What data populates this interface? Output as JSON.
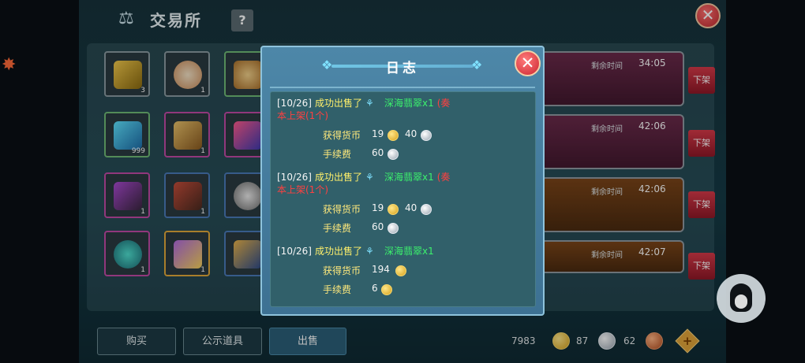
{
  "trade": {
    "title": "交易所",
    "help_label": "?",
    "close_label": "✕",
    "inventory": [
      {
        "count": "3"
      },
      {
        "count": "1"
      },
      {
        "count": ""
      },
      {
        "count": "999"
      },
      {
        "count": "1"
      },
      {
        "count": ""
      },
      {
        "count": "1"
      },
      {
        "count": "1"
      },
      {
        "count": ""
      },
      {
        "count": "1"
      },
      {
        "count": "1"
      },
      {
        "count": ""
      }
    ],
    "listings": [
      {
        "time_label": "剩余时间",
        "time": "34:05",
        "delist": "下架"
      },
      {
        "time_label": "剩余时间",
        "time": "42:06",
        "delist": "下架"
      },
      {
        "time_label": "剩余时间",
        "time": "42:06",
        "delist": "下架"
      },
      {
        "time_label": "剩余时间",
        "time": "42:07",
        "delist": "下架"
      }
    ],
    "tabs": {
      "buy": "购买",
      "showcase": "公示道具",
      "sell": "出售"
    },
    "currency": {
      "gold": "7983",
      "silver": "87",
      "copper": "62"
    }
  },
  "log": {
    "title": "日志",
    "close_label": "✕",
    "entries": [
      {
        "date": "[10/26]",
        "sold": "成功出售了",
        "item": "深海翡翠x1",
        "extra_a": "(奏",
        "extra_b": "本上架(1个)",
        "earn_label": "获得货币",
        "earn_gold": "19",
        "earn_silver": "40",
        "fee_label": "手续费",
        "fee_val": "60"
      },
      {
        "date": "[10/26]",
        "sold": "成功出售了",
        "item": "深海翡翠x1",
        "extra_a": "(奏",
        "extra_b": "本上架(1个)",
        "earn_label": "获得货币",
        "earn_gold": "19",
        "earn_silver": "40",
        "fee_label": "手续费",
        "fee_val": "60"
      },
      {
        "date": "[10/26]",
        "sold": "成功出售了",
        "item": "深海翡翠x1",
        "earn_label": "获得货币",
        "earn_gold": "194",
        "fee_label": "手续费",
        "fee_val": "6"
      }
    ]
  },
  "colors": {
    "delist": "#c42a3a",
    "gold_text": "#ffe97c",
    "item_green": "#3cf06d",
    "warn_red": "#ff4040"
  }
}
